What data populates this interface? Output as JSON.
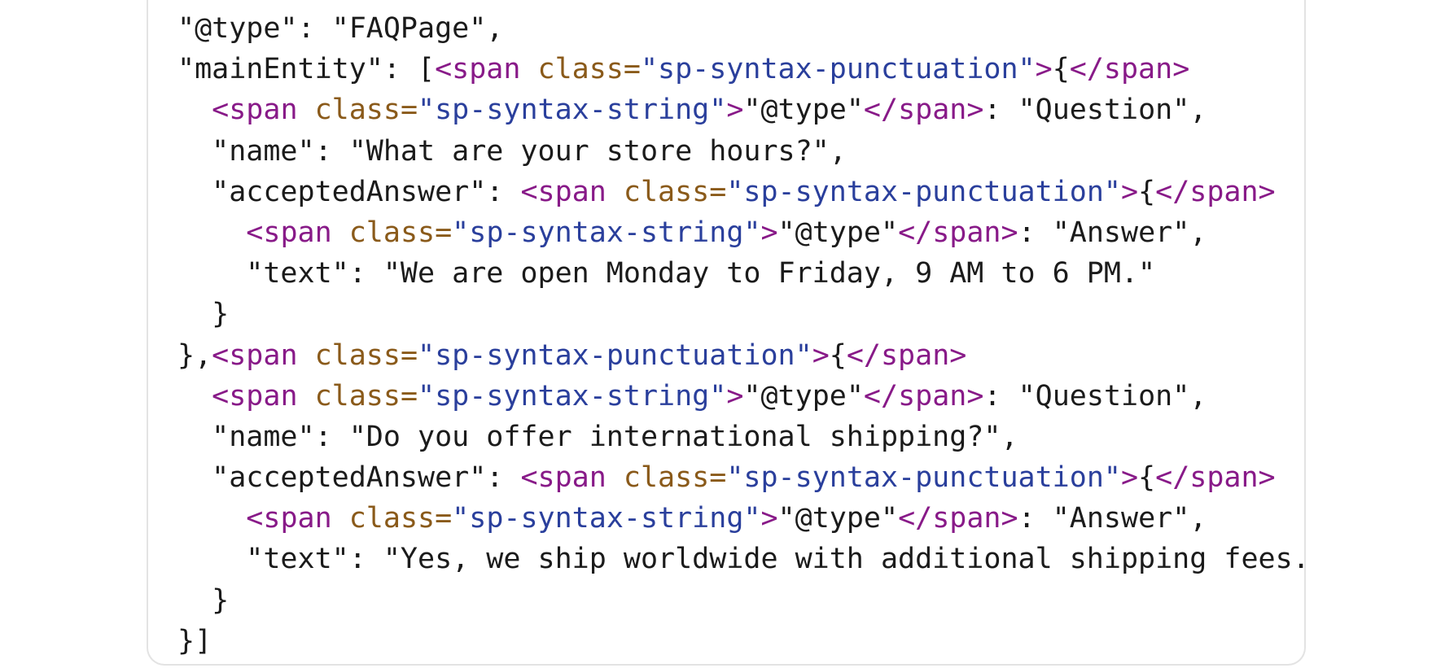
{
  "code_view": {
    "lines": [
      [
        {
          "t": "\"@type\": \"FAQPage\",",
          "c": "txt"
        }
      ],
      [
        {
          "t": "\"mainEntity\": [",
          "c": "txt"
        },
        {
          "t": "<span ",
          "c": "tag"
        },
        {
          "t": "class=",
          "c": "attr"
        },
        {
          "t": "\"sp-syntax-punctuation\"",
          "c": "val"
        },
        {
          "t": ">",
          "c": "tag"
        },
        {
          "t": "{",
          "c": "txt"
        },
        {
          "t": "</span>",
          "c": "tag"
        }
      ],
      [
        {
          "t": "  ",
          "c": "txt"
        },
        {
          "t": "<span ",
          "c": "tag"
        },
        {
          "t": "class=",
          "c": "attr"
        },
        {
          "t": "\"sp-syntax-string\"",
          "c": "val"
        },
        {
          "t": ">",
          "c": "tag"
        },
        {
          "t": "\"@type\"",
          "c": "txt"
        },
        {
          "t": "</span>",
          "c": "tag"
        },
        {
          "t": ": \"Question\",",
          "c": "txt"
        }
      ],
      [
        {
          "t": "  \"name\": \"What are your store hours?\",",
          "c": "txt"
        }
      ],
      [
        {
          "t": "  \"acceptedAnswer\": ",
          "c": "txt"
        },
        {
          "t": "<span ",
          "c": "tag"
        },
        {
          "t": "class=",
          "c": "attr"
        },
        {
          "t": "\"sp-syntax-punctuation\"",
          "c": "val"
        },
        {
          "t": ">",
          "c": "tag"
        },
        {
          "t": "{",
          "c": "txt"
        },
        {
          "t": "</span>",
          "c": "tag"
        }
      ],
      [
        {
          "t": "    ",
          "c": "txt"
        },
        {
          "t": "<span ",
          "c": "tag"
        },
        {
          "t": "class=",
          "c": "attr"
        },
        {
          "t": "\"sp-syntax-string\"",
          "c": "val"
        },
        {
          "t": ">",
          "c": "tag"
        },
        {
          "t": "\"@type\"",
          "c": "txt"
        },
        {
          "t": "</span>",
          "c": "tag"
        },
        {
          "t": ": \"Answer\",",
          "c": "txt"
        }
      ],
      [
        {
          "t": "    \"text\": \"We are open Monday to Friday, 9 AM to 6 PM.\"",
          "c": "txt"
        }
      ],
      [
        {
          "t": "  }",
          "c": "txt"
        }
      ],
      [
        {
          "t": "},",
          "c": "txt"
        },
        {
          "t": "<span ",
          "c": "tag"
        },
        {
          "t": "class=",
          "c": "attr"
        },
        {
          "t": "\"sp-syntax-punctuation\"",
          "c": "val"
        },
        {
          "t": ">",
          "c": "tag"
        },
        {
          "t": "{",
          "c": "txt"
        },
        {
          "t": "</span>",
          "c": "tag"
        }
      ],
      [
        {
          "t": "  ",
          "c": "txt"
        },
        {
          "t": "<span ",
          "c": "tag"
        },
        {
          "t": "class=",
          "c": "attr"
        },
        {
          "t": "\"sp-syntax-string\"",
          "c": "val"
        },
        {
          "t": ">",
          "c": "tag"
        },
        {
          "t": "\"@type\"",
          "c": "txt"
        },
        {
          "t": "</span>",
          "c": "tag"
        },
        {
          "t": ": \"Question\",",
          "c": "txt"
        }
      ],
      [
        {
          "t": "  \"name\": \"Do you offer international shipping?\",",
          "c": "txt"
        }
      ],
      [
        {
          "t": "  \"acceptedAnswer\": ",
          "c": "txt"
        },
        {
          "t": "<span ",
          "c": "tag"
        },
        {
          "t": "class=",
          "c": "attr"
        },
        {
          "t": "\"sp-syntax-punctuation\"",
          "c": "val"
        },
        {
          "t": ">",
          "c": "tag"
        },
        {
          "t": "{",
          "c": "txt"
        },
        {
          "t": "</span>",
          "c": "tag"
        }
      ],
      [
        {
          "t": "    ",
          "c": "txt"
        },
        {
          "t": "<span ",
          "c": "tag"
        },
        {
          "t": "class=",
          "c": "attr"
        },
        {
          "t": "\"sp-syntax-string\"",
          "c": "val"
        },
        {
          "t": ">",
          "c": "tag"
        },
        {
          "t": "\"@type\"",
          "c": "txt"
        },
        {
          "t": "</span>",
          "c": "tag"
        },
        {
          "t": ": \"Answer\",",
          "c": "txt"
        }
      ],
      [
        {
          "t": "    \"text\": \"Yes, we ship worldwide with additional shipping fees.",
          "c": "txt"
        }
      ],
      [
        {
          "t": "  }",
          "c": "txt"
        }
      ],
      [
        {
          "t": "}]",
          "c": "txt"
        }
      ]
    ]
  },
  "colors": {
    "tag": "#881a88",
    "attribute": "#8a5a1a",
    "attribute_value": "#2a3f9c",
    "text": "#1b1b1b",
    "border": "#e3e3e3"
  }
}
